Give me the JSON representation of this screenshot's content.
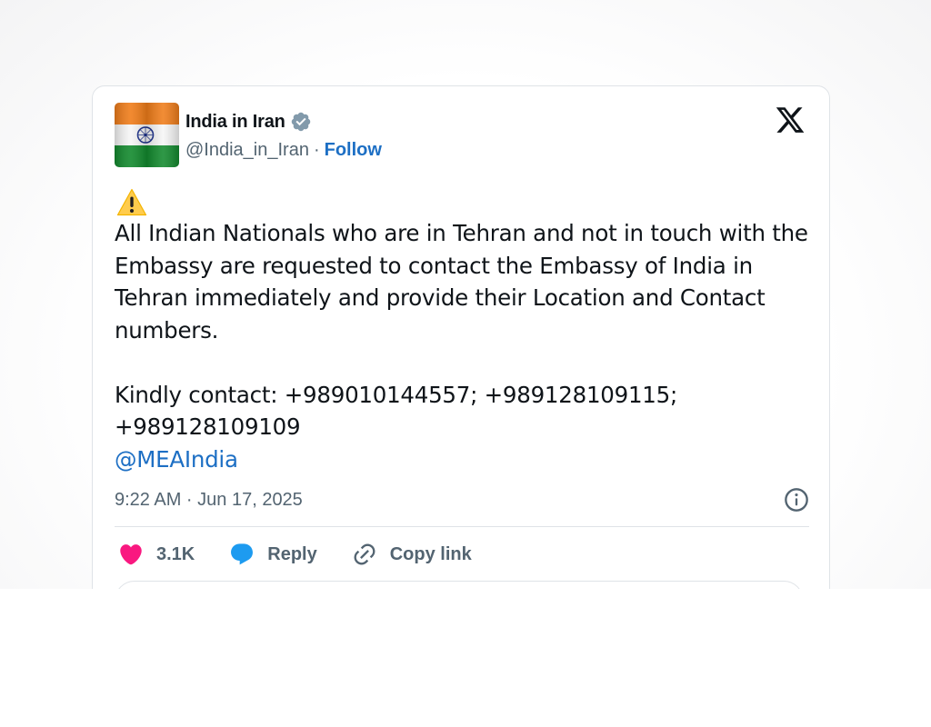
{
  "tweet": {
    "display_name": "India in Iran",
    "handle": "@India_in_Iran",
    "separator": "·",
    "follow_label": "Follow",
    "warning_emoji": "warning-icon",
    "paragraph1": "All Indian Nationals who are in Tehran and not in touch with the Embassy are requested to contact the Embassy of India in Tehran immediately and provide their Location and Contact numbers.",
    "paragraph2": "Kindly contact: +989010144557; +989128109115; +989128109109",
    "mention": "@MEAIndia",
    "timestamp": "9:22 AM · Jun 17, 2025"
  },
  "actions": {
    "like_count": "3.1K",
    "reply_label": "Reply",
    "copy_label": "Copy link"
  },
  "icons": {
    "avatar": "india-flag-avatar",
    "verified": "verified-badge-icon",
    "brand": "x-logo-icon",
    "info": "info-icon",
    "like": "heart-icon",
    "reply": "reply-bubble-icon",
    "copy": "link-icon"
  },
  "colors": {
    "text": "#0f1419",
    "secondary": "#536471",
    "link": "#1d6fc4",
    "heart": "#f91880",
    "reply": "#1d9bf0",
    "verified": "#829aab"
  }
}
